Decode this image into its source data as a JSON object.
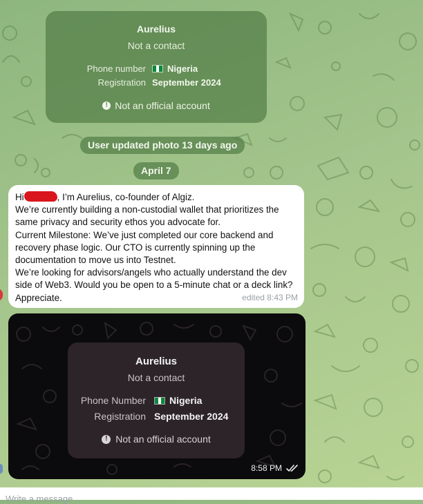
{
  "info_card": {
    "name": "Aurelius",
    "subtitle": "Not a contact",
    "phone_label": "Phone number",
    "phone_value": "Nigeria",
    "registration_label": "Registration",
    "registration_value": "September 2024",
    "official_text": "Not an official account"
  },
  "service_messages": {
    "photo_update": "User updated photo 13 days ago",
    "date": "April 7"
  },
  "message": {
    "line1_prefix": "Hi",
    "line1_suffix": ", I’m Aurelius, co-founder of Algiz.",
    "line2": "We’re currently building a non-custodial wallet that prioritizes the",
    "line3": "same privacy and security ethos you advocate for.",
    "line4": "Current Milestone: We’ve just completed our core backend and",
    "line5": "recovery phase logic. Our CTO is currently spinning up the",
    "line6": "documentation to move us into Testnet.",
    "line7": "We’re looking for advisors/angels who actually understand the dev",
    "line8": "side of Web3. Would you be open to a 5-minute chat or a deck link?",
    "line9": "Appreciate.",
    "meta": "edited 8:43 PM"
  },
  "image_message": {
    "name": "Aurelius",
    "subtitle": "Not a contact",
    "phone_label": "Phone Number",
    "phone_value": "Nigeria",
    "registration_label": "Registration",
    "registration_value": "September 2024",
    "official_text": "Not an official account",
    "time": "8:58 PM",
    "status_icon": "double-check-icon"
  },
  "composer": {
    "placeholder": "Write a message..."
  },
  "colors": {
    "background": "#a4c58c",
    "service_bubble": "#537d46",
    "flag_green": "#0a8a3c",
    "redaction": "#d9161d"
  }
}
